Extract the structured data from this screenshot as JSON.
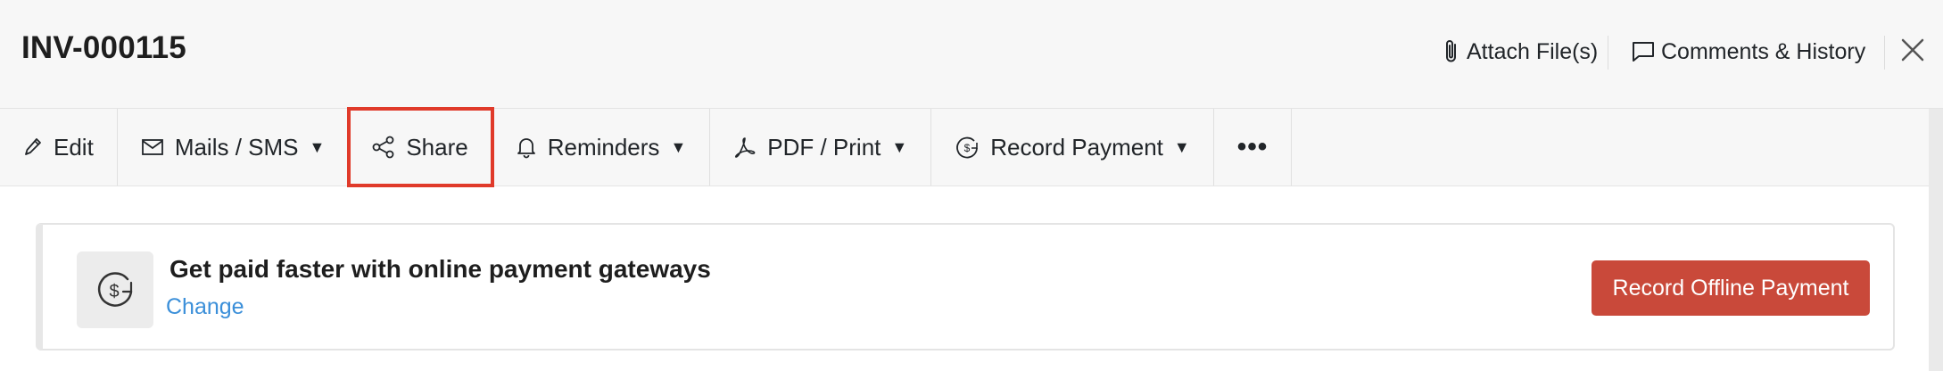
{
  "header": {
    "title": "INV-000115",
    "attach_label": "Attach File(s)",
    "comments_label": "Comments & History"
  },
  "toolbar": {
    "edit_label": "Edit",
    "mails_label": "Mails / SMS",
    "share_label": "Share",
    "reminders_label": "Reminders",
    "pdf_label": "PDF / Print",
    "record_payment_label": "Record Payment",
    "more_label": "•••",
    "caret": "▼"
  },
  "banner": {
    "title": "Get paid faster with online payment gateways",
    "link_label": "Change",
    "button_label": "Record Offline Payment"
  },
  "colors": {
    "primary_button": "#c9493a",
    "link": "#3b8fd9",
    "highlight_outline": "#e03a2a"
  }
}
